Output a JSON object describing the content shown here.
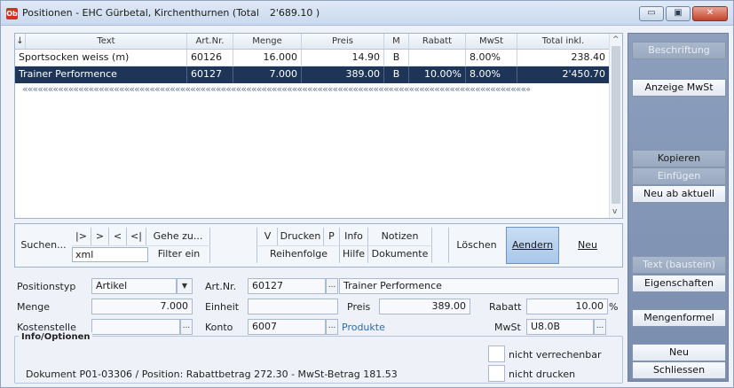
{
  "window": {
    "app_icon_label": "Ob",
    "title": "Positionen - EHC Gürbetal, Kirchenthurnen (Total",
    "title_total": "2'689.10 )",
    "minimize_glyph": "▭",
    "maximize_glyph": "▣",
    "close_glyph": "✕"
  },
  "grid": {
    "sort_indicator": "↓",
    "columns": [
      "Text",
      "Art.Nr.",
      "Menge",
      "Preis",
      "M",
      "Rabatt",
      "MwSt",
      "Total inkl."
    ],
    "rows": [
      {
        "text": "Sportsocken weiss (m)",
        "artnr": "60126",
        "menge": "16.000",
        "preis": "14.90",
        "m": "B",
        "rabatt": "",
        "mwst": "8.00%",
        "total": "238.40",
        "selected": false
      },
      {
        "text": "Trainer Performence",
        "artnr": "60127",
        "menge": "7.000",
        "preis": "389.00",
        "m": "B",
        "rabatt": "10.00%",
        "mwst": "8.00%",
        "total": "2'450.70",
        "selected": true
      }
    ],
    "ellipsis_row": "«««««««««««««««««««««««««««««««««««««««««««««««««««««««««««««««««««««««««««««««««««««««««««««««««««««««««««««««««««««««««««««««««««»»»»»»»»»»»»»»»»»»»»»»»»»»»»»»»»»»»»»»»»»»»»»»»»»»»»»»»»»»»»»»»»»»»»»»»»»»»»»»»»",
    "scroll_up": "^",
    "scroll_down": "v"
  },
  "toolbar": {
    "suchen": "Suchen...",
    "nav_first": "|>",
    "nav_next": ">",
    "nav_prev": "<",
    "nav_last": "<|",
    "gehe_zu": "Gehe zu...",
    "search_value": "xml",
    "filter_ein": "Filter ein",
    "v": "V",
    "drucken": "Drucken",
    "p": "P",
    "info": "Info",
    "notizen": "Notizen",
    "reihenfolge": "Reihenfolge",
    "hilfe": "Hilfe",
    "dokumente": "Dokumente",
    "loeschen": "Löschen",
    "aendern": "Aendern",
    "neu": "Neu"
  },
  "form": {
    "positionstyp_label": "Positionstyp",
    "positionstyp_value": "Artikel",
    "artnr_label": "Art.Nr.",
    "artnr_value": "60127",
    "artikel_name": "Trainer Performence",
    "menge_label": "Menge",
    "menge_value": "7.000",
    "einheit_label": "Einheit",
    "einheit_value": "",
    "preis_label": "Preis",
    "preis_value": "389.00",
    "rabatt_label": "Rabatt",
    "rabatt_value": "10.00",
    "rabatt_unit": "%",
    "kostenstelle_label": "Kostenstelle",
    "kostenstelle_value": "",
    "konto_label": "Konto",
    "konto_value": "6007",
    "konto_name": "Produkte",
    "mwst_label": "MwSt",
    "mwst_value": "U8.0B",
    "dots": "...",
    "dd_arrow": "▼"
  },
  "info": {
    "title": "Info/Optionen",
    "status_text": "Dokument P01-03306  /  Position: Rabattbetrag 272.30  -  MwSt-Betrag 181.53",
    "nicht_verrechenbar": "nicht verrechenbar",
    "nicht_drucken": "nicht drucken"
  },
  "sidebar": {
    "beschriftung": "Beschriftung",
    "anzeige_mwst": "Anzeige MwSt",
    "kopieren": "Kopieren",
    "einfuegen": "Einfügen",
    "neu_ab_aktuell": "Neu ab aktuell",
    "text_baustein": "Text (baustein)",
    "eigenschaften": "Eigenschaften",
    "mengenformel": "Mengenformel",
    "neu": "Neu",
    "schliessen": "Schliessen"
  }
}
